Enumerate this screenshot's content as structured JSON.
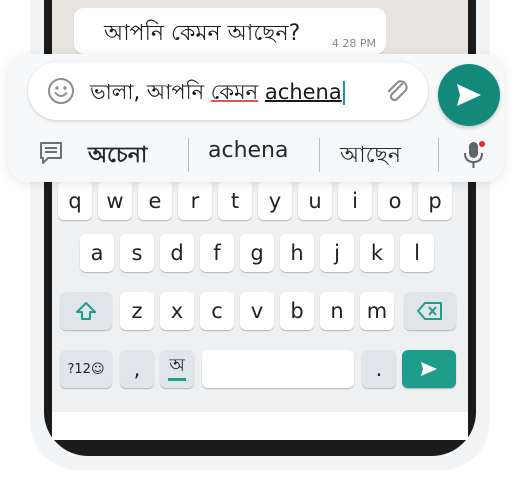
{
  "chat": {
    "message_text": "আপনি কেমন আছেন?",
    "message_time": "4 28 PM"
  },
  "composer": {
    "text_plain": "ভালা, আপনি ",
    "text_misspelled": "কেমন",
    "text_space": " ",
    "text_current": "achena",
    "emoji_icon": "emoji-icon",
    "attach_icon": "paperclip-icon",
    "send_icon": "send-icon"
  },
  "suggestions": {
    "items": [
      "অচেনা",
      "achena",
      "আছেন"
    ],
    "clipboard_icon": "clipboard-icon",
    "mic_icon": "microphone-icon"
  },
  "keyboard": {
    "row1": [
      "q",
      "w",
      "e",
      "r",
      "t",
      "y",
      "u",
      "i",
      "o",
      "p"
    ],
    "row2": [
      "a",
      "s",
      "d",
      "f",
      "g",
      "h",
      "j",
      "k",
      "l"
    ],
    "row3": [
      "z",
      "x",
      "c",
      "v",
      "b",
      "n",
      "m"
    ],
    "symbols_label": "?12☺",
    "comma_label": ",",
    "lang_label": "অ",
    "period_label": ".",
    "accent_color": "#1e9c8c"
  }
}
